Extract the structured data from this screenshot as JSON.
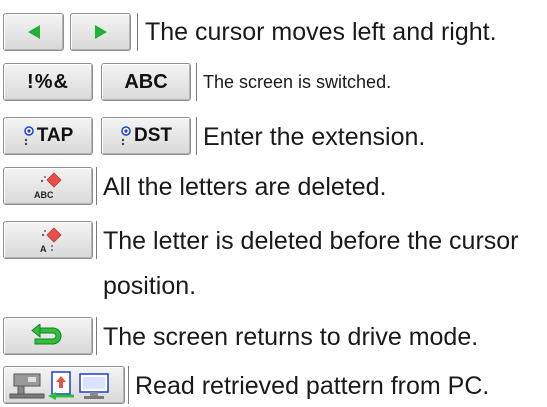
{
  "rows": [
    {
      "buttons": [
        {
          "icon": "arrow-left-icon"
        },
        {
          "icon": "arrow-right-icon"
        }
      ],
      "text": "The cursor moves left and right."
    },
    {
      "buttons": [
        {
          "label": "!%&"
        },
        {
          "label": "ABC"
        }
      ],
      "text": "The screen is switched."
    },
    {
      "buttons": [
        {
          "label": "TAP",
          "icon": "file-extension-icon"
        },
        {
          "label": "DST",
          "icon": "file-extension-icon"
        }
      ],
      "text": "Enter the extension."
    },
    {
      "buttons": [
        {
          "icon": "delete-all-icon",
          "label": "ABC"
        }
      ],
      "text": "All the letters are deleted."
    },
    {
      "buttons": [
        {
          "icon": "delete-letter-icon",
          "label": "A"
        }
      ],
      "text": "The letter is deleted before the cursor",
      "text2": "position."
    },
    {
      "buttons": [
        {
          "icon": "return-icon"
        }
      ],
      "text": "The screen returns to drive mode."
    },
    {
      "buttons": [
        {
          "icon": "read-from-pc-icon"
        }
      ],
      "text": "Read retrieved pattern from PC."
    }
  ],
  "colors": {
    "arrow": "#22b03a",
    "return": "#2fbf3a",
    "diamond": "#e8504a",
    "blue": "#1e3fd0"
  }
}
